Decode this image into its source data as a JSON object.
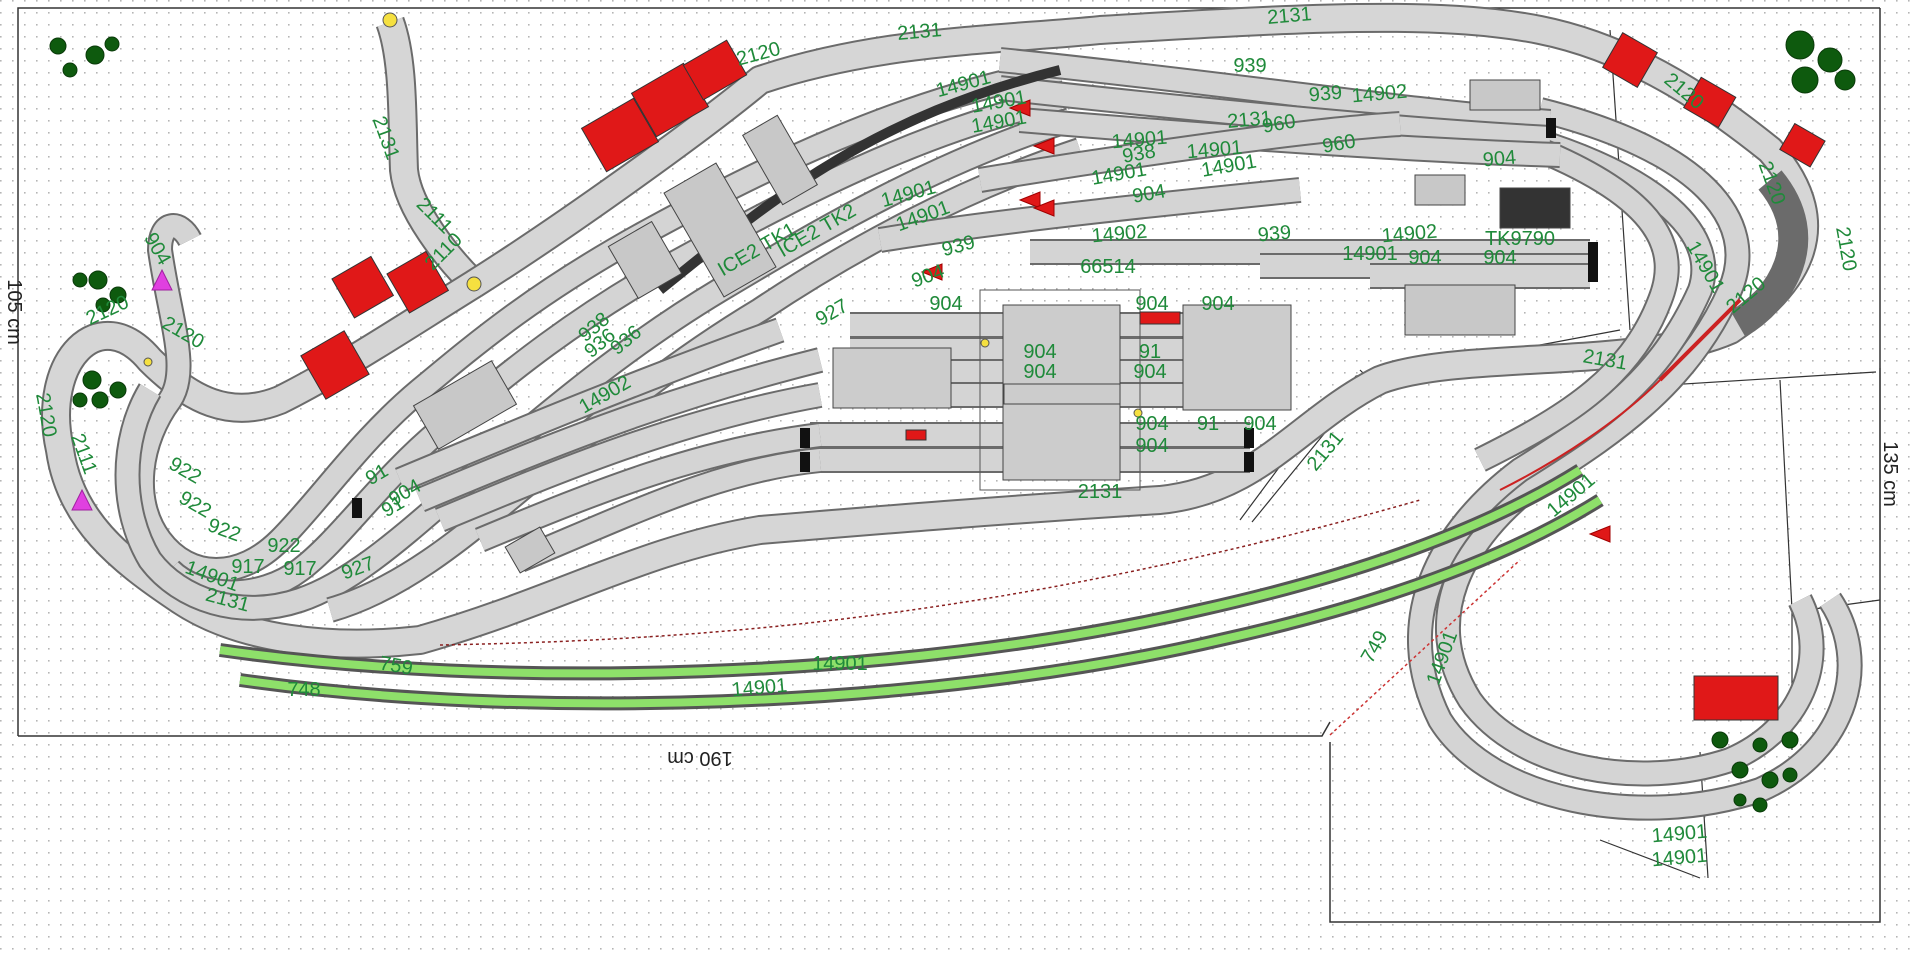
{
  "layout": {
    "dimensions": {
      "width": "190 cm",
      "height": "135 cm",
      "left": "105 cm"
    },
    "colors": {
      "background": "#ffffff",
      "grid_dot": "#b5b5b5",
      "track": "#d4d4d4",
      "track_border": "#6b6b6b",
      "label": "#1f8a3a",
      "house": "#e01818",
      "signal": "#e01818",
      "marker": "#e040e0",
      "tree": "#0e5a0e",
      "green_track": "#8ee06a",
      "dark_track": "#333333",
      "platform": "#cccccc"
    },
    "labels": [
      {
        "id": "l1",
        "text": "2131"
      },
      {
        "id": "l2",
        "text": "2120"
      },
      {
        "id": "l3",
        "text": "2131"
      },
      {
        "id": "l4",
        "text": "939"
      },
      {
        "id": "l5",
        "text": "14902"
      },
      {
        "id": "l6",
        "text": "14901"
      },
      {
        "id": "l7",
        "text": "14901"
      },
      {
        "id": "l8",
        "text": "14901"
      },
      {
        "id": "l9",
        "text": "2131"
      },
      {
        "id": "l10",
        "text": "2111"
      },
      {
        "id": "l11",
        "text": "2110"
      },
      {
        "id": "l12",
        "text": "2120"
      },
      {
        "id": "l13",
        "text": "2120"
      },
      {
        "id": "l14",
        "text": "904"
      },
      {
        "id": "l15",
        "text": "14901"
      },
      {
        "id": "l16",
        "text": "14901"
      },
      {
        "id": "l17",
        "text": "904"
      },
      {
        "id": "l18",
        "text": "939"
      },
      {
        "id": "l19",
        "text": "14902"
      },
      {
        "id": "l20",
        "text": "939"
      },
      {
        "id": "l21",
        "text": "14902"
      },
      {
        "id": "l22",
        "text": "904"
      },
      {
        "id": "l23",
        "text": "904"
      },
      {
        "id": "l24",
        "text": "66514"
      },
      {
        "id": "l25",
        "text": "904"
      },
      {
        "id": "l26",
        "text": "904"
      },
      {
        "id": "l27",
        "text": "904"
      },
      {
        "id": "l28",
        "text": "904"
      },
      {
        "id": "l29",
        "text": "904"
      },
      {
        "id": "l30",
        "text": "91"
      },
      {
        "id": "l31",
        "text": "904"
      },
      {
        "id": "l32",
        "text": "904"
      },
      {
        "id": "l33",
        "text": "91"
      },
      {
        "id": "l34",
        "text": "904"
      },
      {
        "id": "l35",
        "text": "2131"
      },
      {
        "id": "l36",
        "text": "938"
      },
      {
        "id": "l37",
        "text": "936"
      },
      {
        "id": "l38",
        "text": "14902"
      },
      {
        "id": "l39",
        "text": "927"
      },
      {
        "id": "l40",
        "text": "922"
      },
      {
        "id": "l41",
        "text": "922"
      },
      {
        "id": "l42",
        "text": "922"
      },
      {
        "id": "l43",
        "text": "922"
      },
      {
        "id": "l44",
        "text": "917"
      },
      {
        "id": "l45",
        "text": "917"
      },
      {
        "id": "l46",
        "text": "927"
      },
      {
        "id": "l47",
        "text": "14901"
      },
      {
        "id": "l48",
        "text": "2131"
      },
      {
        "id": "l49",
        "text": "2111"
      },
      {
        "id": "l50",
        "text": "2120"
      },
      {
        "id": "l51",
        "text": "2131"
      },
      {
        "id": "l52",
        "text": "2131"
      },
      {
        "id": "l53",
        "text": "759"
      },
      {
        "id": "l54",
        "text": "14901"
      },
      {
        "id": "l55",
        "text": "14901"
      },
      {
        "id": "l56",
        "text": "748"
      },
      {
        "id": "l57",
        "text": "749"
      },
      {
        "id": "l58",
        "text": "14901"
      },
      {
        "id": "l59",
        "text": "14901"
      },
      {
        "id": "l60",
        "text": "14901"
      },
      {
        "id": "l61",
        "text": "14901"
      },
      {
        "id": "l62",
        "text": "14901"
      },
      {
        "id": "l63",
        "text": "2120"
      },
      {
        "id": "l64",
        "text": "2120"
      },
      {
        "id": "l65",
        "text": "14901"
      },
      {
        "id": "l66",
        "text": "14901"
      },
      {
        "id": "l67",
        "text": "ICE2 TK1"
      },
      {
        "id": "l68",
        "text": "ICE2 TK2"
      },
      {
        "id": "l69",
        "text": "TK9790"
      },
      {
        "id": "l70",
        "text": "2120"
      },
      {
        "id": "l71",
        "text": "2120"
      },
      {
        "id": "l72",
        "text": "960"
      },
      {
        "id": "l73",
        "text": "960"
      },
      {
        "id": "l74",
        "text": "938"
      },
      {
        "id": "l75",
        "text": "904"
      },
      {
        "id": "l76",
        "text": "14901"
      },
      {
        "id": "l77",
        "text": "2131"
      },
      {
        "id": "l78",
        "text": "14901"
      },
      {
        "id": "l79",
        "text": "91"
      },
      {
        "id": "l80",
        "text": "904"
      },
      {
        "id": "l81",
        "text": "91"
      },
      {
        "id": "l82",
        "text": "904"
      },
      {
        "id": "l83",
        "text": "14901"
      },
      {
        "id": "l84",
        "text": "939"
      },
      {
        "id": "l85",
        "text": "936"
      },
      {
        "id": "l86",
        "text": "904"
      }
    ]
  }
}
